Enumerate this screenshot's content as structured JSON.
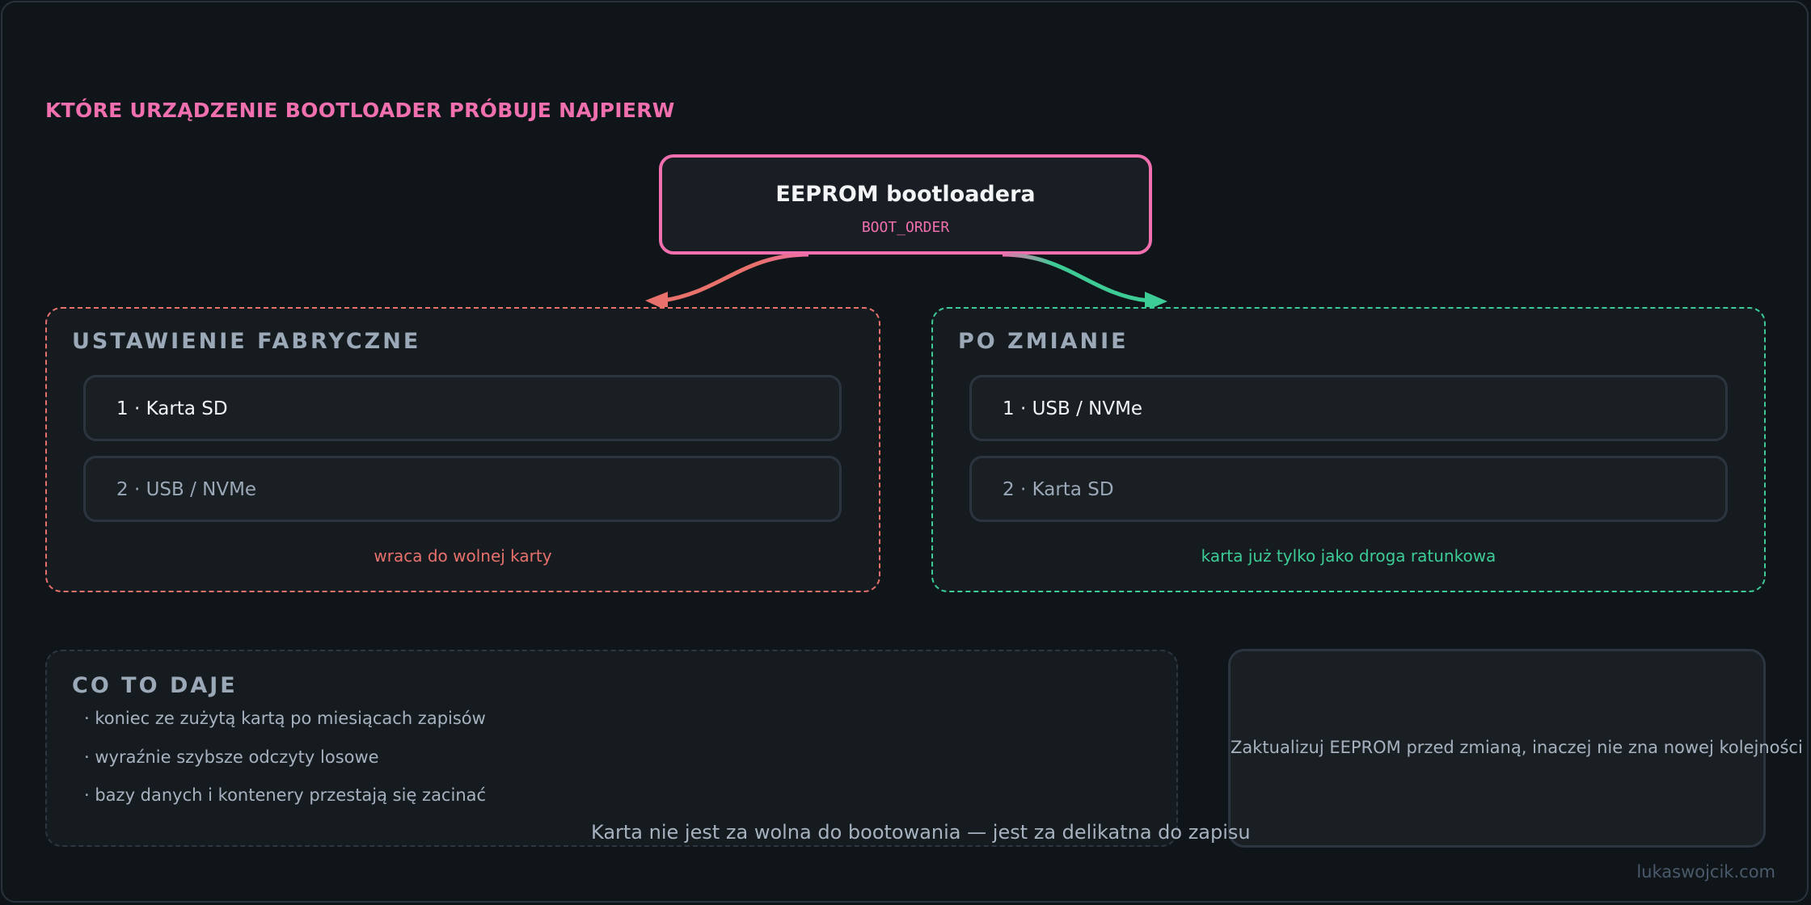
{
  "title": "KTÓRE URZĄDZENIE BOOTLOADER PRÓBUJE NAJPIERW",
  "eeprom": {
    "title": "EEPROM bootloadera",
    "subtitle": "BOOT_ORDER"
  },
  "factory": {
    "heading": "USTAWIENIE FABRYCZNE",
    "items": [
      "1 · Karta SD",
      "2 · USB / NVMe"
    ],
    "note": "wraca do wolnej karty",
    "color": "#e8716c"
  },
  "changed": {
    "heading": "PO ZMIANIE",
    "items": [
      "1 · USB / NVMe",
      "2 · Karta SD"
    ],
    "note": "karta już tylko jako droga ratunkowa",
    "color": "#3dcc96"
  },
  "benefits": {
    "heading": "CO TO DAJE",
    "items": [
      "· koniec ze zużytą kartą po miesiącach zapisów",
      "· wyraźnie szybsze odczyty losowe",
      "· bazy danych i kontenery przestają się zacinać"
    ]
  },
  "warning": "Zaktualizuj EEPROM przed zmianą, inaczej nie zna nowej kolejności",
  "quote": "Karta nie jest za wolna do bootowania — jest za delikatna do zapisu",
  "watermark": "lukaswojcik.com",
  "colors": {
    "accent": "#f06fae",
    "factory": "#e8716c",
    "changed": "#3dcc96"
  }
}
